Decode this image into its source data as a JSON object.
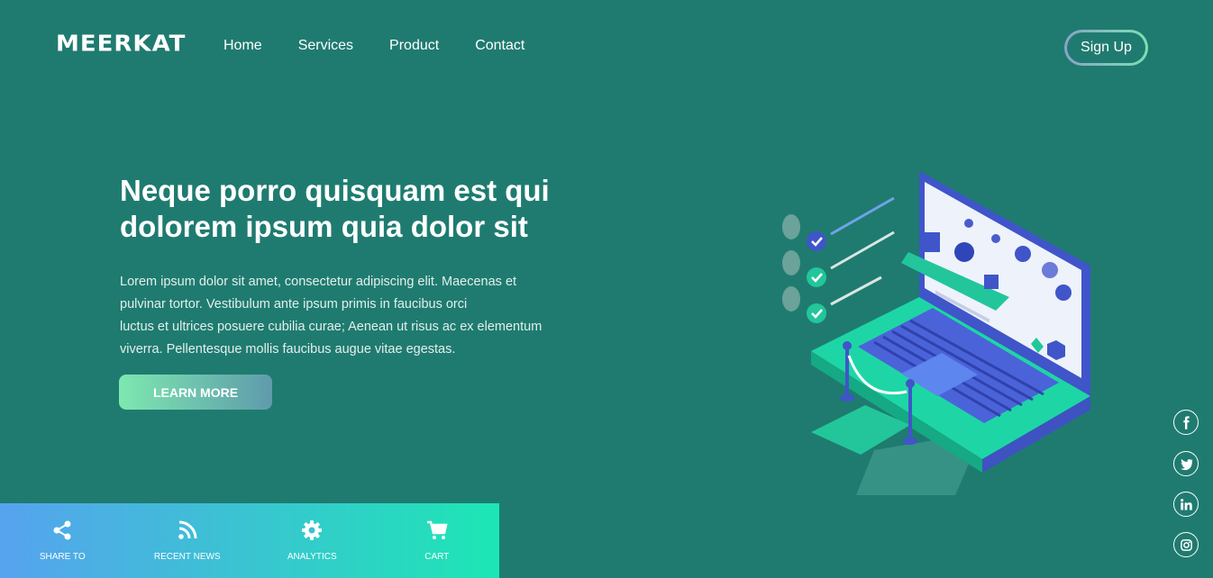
{
  "brand": {
    "logo": "MEERKAT"
  },
  "nav": {
    "items": [
      "Home",
      "Services",
      "Product",
      "Contact"
    ],
    "signup": "Sign Up"
  },
  "hero": {
    "title": "Neque porro quisquam est qui dolorem ipsum quia dolor sit",
    "body_lines": [
      "Lorem ipsum dolor sit amet, consectetur adipiscing elit. Maecenas et",
      "pulvinar tortor. Vestibulum ante ipsum primis in faucibus orci",
      "luctus et ultrices posuere cubilia curae; Aenean ut risus ac ex elementum",
      "viverra. Pellentesque mollis faucibus augue vitae egestas."
    ],
    "cta": "LEARN MORE"
  },
  "bottombar": {
    "items": [
      {
        "label": "SHARE TO",
        "icon": "share-icon"
      },
      {
        "label": "RECENT NEWS",
        "icon": "rss-icon"
      },
      {
        "label": "ANALYTICS",
        "icon": "gear-icon"
      },
      {
        "label": "CART",
        "icon": "cart-icon"
      }
    ]
  },
  "social": [
    "facebook-icon",
    "twitter-icon",
    "linkedin-icon",
    "instagram-icon"
  ],
  "colors": {
    "background": "#1f7b70",
    "accent_green": "#1de6b4",
    "accent_blue": "#56a3ee",
    "laptop_blue": "#4a5ccc"
  }
}
